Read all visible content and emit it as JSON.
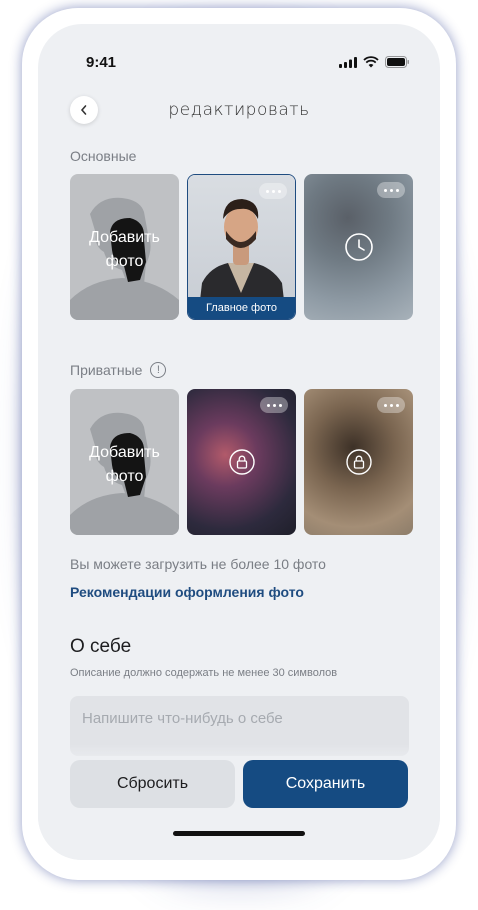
{
  "status": {
    "time": "9:41"
  },
  "header": {
    "title": "редактировать"
  },
  "sections": {
    "main_label": "Основные",
    "private_label": "Приватные"
  },
  "tiles": {
    "add_label": "Добавить фото",
    "main_badge": "Главное фото"
  },
  "limit_text": "Вы можете загрузить не более 10 фото",
  "recommendations_link": "Рекомендации оформления фото",
  "about": {
    "title": "О себе",
    "hint": "Описание должно содержать не менее 30 символов",
    "placeholder": "Напишите что-нибудь о себе",
    "value": ""
  },
  "actions": {
    "reset_label": "Сбросить",
    "save_label": "Сохранить"
  },
  "colors": {
    "accent": "#154b82",
    "background": "#eef0f3",
    "glow": "#283ca0"
  }
}
